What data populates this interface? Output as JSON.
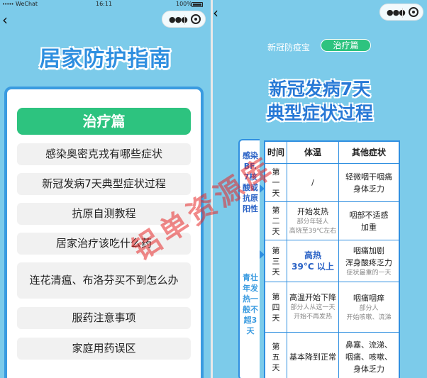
{
  "status_bar": {
    "signal": "•••••",
    "carrier": "WeChat",
    "time": "16:11",
    "battery": "100%"
  },
  "left": {
    "title": "居家防护指南",
    "section_button": "治疗篇",
    "menu": [
      "感染奥密克戎有哪些症状",
      "新冠发病7天典型症状过程",
      "抗原自测教程",
      "居家治疗该吃什么药",
      "连花清瘟、布洛芬买不到怎么办",
      "服药注意事项",
      "家庭用药误区"
    ]
  },
  "right": {
    "app_name": "新冠防疫宝",
    "tag": "治疗篇",
    "headline_1": "新冠发病7天",
    "headline_2": "典型症状过程",
    "side_top": "感染BF.7核酸或抗原阳性",
    "side_bottom": "青壮年发热一般不超3天",
    "table": {
      "headers": [
        "时间",
        "体温",
        "其他症状"
      ],
      "rows": [
        {
          "day": "第一天",
          "temp": [
            "/"
          ],
          "temp_note": [],
          "other": [
            "轻微咽干咽痛",
            "身体乏力"
          ],
          "other_note": []
        },
        {
          "day": "第二天",
          "temp": [
            "开始发热"
          ],
          "temp_note": [
            "部分年轻人",
            "高烧至39℃左右"
          ],
          "other": [
            "咽部不适感",
            "加重"
          ],
          "other_note": []
        },
        {
          "day": "第三天",
          "temp": [
            "高热",
            "39°C 以上"
          ],
          "temp_note": [],
          "other": [
            "咽痛加剧",
            "浑身酸疼乏力"
          ],
          "other_note": [
            "症状最重的一天"
          ]
        },
        {
          "day": "第四天",
          "temp": [
            "高温开始下降"
          ],
          "temp_note": [
            "部分人从这一天",
            "开始不再发热"
          ],
          "other": [
            "咽痛咽痒"
          ],
          "other_note": [
            "部分人",
            "开始咳嗽、流涕"
          ]
        },
        {
          "day": "第五天",
          "temp": [
            "基本降到正常"
          ],
          "temp_note": [],
          "other": [
            "鼻塞、流涕、",
            "咽痛、咳嗽、",
            "身体乏力"
          ],
          "other_note": []
        }
      ]
    }
  },
  "watermark": "铝单资源库",
  "colors": {
    "sky": "#7ccbea",
    "blue": "#2f8fe0",
    "green": "#2dc37f",
    "watermark": "#e62828"
  }
}
